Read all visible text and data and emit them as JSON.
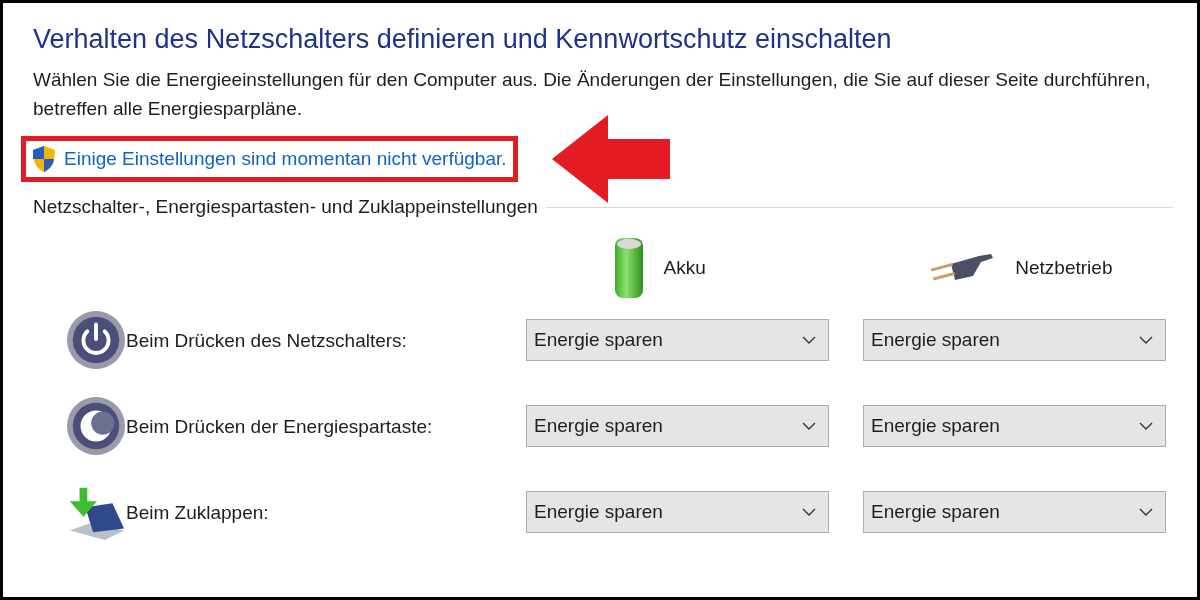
{
  "title": "Verhalten des Netzschalters definieren und Kennwortschutz einschalten",
  "description": "Wählen Sie die Energieeinstellungen für den Computer aus. Die Änderungen der Einstellungen, die Sie auf dieser Seite durchführen, betreffen alle Energiesparpläne.",
  "notice": {
    "text": "Einige Einstellungen sind momentan nicht verfügbar.",
    "highlighted": true
  },
  "section": {
    "title": "Netzschalter-, Energiespartasten- und Zuklappeinstellungen",
    "columns": [
      {
        "kind": "battery",
        "label": "Akku"
      },
      {
        "kind": "plug",
        "label": "Netzbetrieb"
      }
    ],
    "rows": [
      {
        "kind": "power",
        "label": "Beim Drücken des Netzschalters:",
        "values": [
          "Energie sparen",
          "Energie sparen"
        ]
      },
      {
        "kind": "sleep",
        "label": "Beim Drücken der Energiespartaste:",
        "values": [
          "Energie sparen",
          "Energie sparen"
        ]
      },
      {
        "kind": "lid",
        "label": "Beim Zuklappen:",
        "values": [
          "Energie sparen",
          "Energie sparen"
        ]
      }
    ]
  }
}
